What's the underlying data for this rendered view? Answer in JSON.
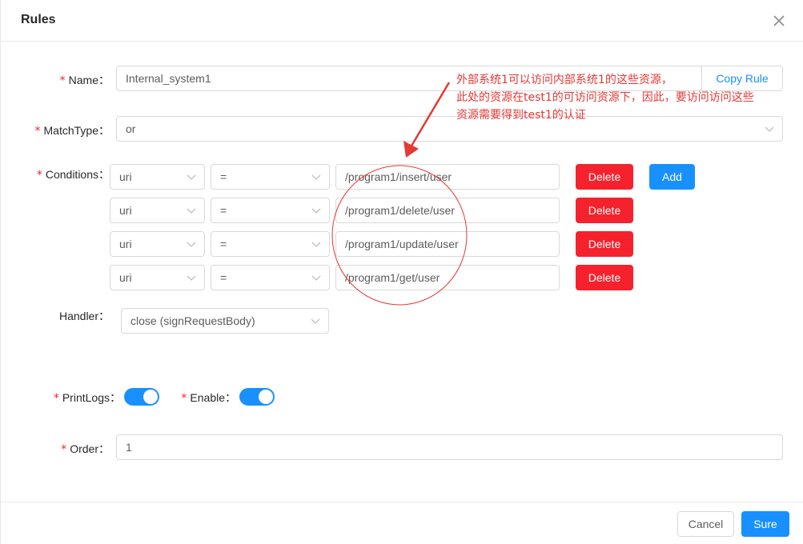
{
  "modal": {
    "title": "Rules"
  },
  "form": {
    "name": {
      "label": "Name",
      "value": "Internal_system1",
      "copy_button": "Copy Rule"
    },
    "match_type": {
      "label": "MatchType",
      "value": "or"
    },
    "conditions": {
      "label": "Conditions",
      "rows": [
        {
          "param_type": "uri",
          "operator": "=",
          "value": "/program1/insert/user",
          "delete_label": "Delete"
        },
        {
          "param_type": "uri",
          "operator": "=",
          "value": "/program1/delete/user",
          "delete_label": "Delete"
        },
        {
          "param_type": "uri",
          "operator": "=",
          "value": "/program1/update/user",
          "delete_label": "Delete"
        },
        {
          "param_type": "uri",
          "operator": "=",
          "value": "/program1/get/user",
          "delete_label": "Delete"
        }
      ],
      "add_label": "Add"
    },
    "handler": {
      "label": "Handler",
      "value": "close (signRequestBody)"
    },
    "print_logs": {
      "label": "PrintLogs",
      "enabled": true
    },
    "enable": {
      "label": "Enable",
      "enabled": true
    },
    "order": {
      "label": "Order",
      "value": "1"
    }
  },
  "footer": {
    "cancel_label": "Cancel",
    "sure_label": "Sure"
  },
  "annotation": {
    "lines": [
      "外部系统1可以访问内部系统1的这些资源，",
      "此处的资源在test1的可访问资源下，因此，要访问访问这些",
      "资源需要得到test1的认证"
    ],
    "color": "#e53935"
  },
  "colors": {
    "primary": "#1890ff",
    "danger": "#f5222d",
    "required_mark": "#f5222d"
  }
}
